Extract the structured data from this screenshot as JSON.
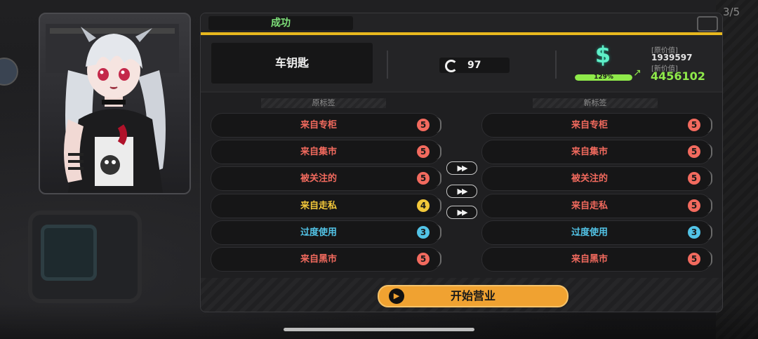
{
  "page_indicator": "3/5",
  "panel": {
    "status": "成功",
    "item_name": "车钥匙",
    "count": "97",
    "price": {
      "percent_text": "129%",
      "percent_fill": 1.0,
      "orig_label": "[原价值]",
      "orig_value": "1939597",
      "new_label": "[新价值]",
      "new_value": "4456102"
    },
    "left_header": "原标签",
    "right_header": "新标签",
    "left_tags": [
      {
        "label": "来自专柜",
        "value": "5",
        "color": "#f26a5e"
      },
      {
        "label": "来自集市",
        "value": "5",
        "color": "#f26a5e"
      },
      {
        "label": "被关注的",
        "value": "5",
        "color": "#f26a5e"
      },
      {
        "label": "来自走私",
        "value": "4",
        "color": "#f3c83a"
      },
      {
        "label": "过度使用",
        "value": "3",
        "color": "#52c3e6"
      },
      {
        "label": "来自黑市",
        "value": "5",
        "color": "#f26a5e"
      }
    ],
    "right_tags": [
      {
        "label": "来自专柜",
        "value": "5",
        "color": "#f26a5e"
      },
      {
        "label": "来自集市",
        "value": "5",
        "color": "#f26a5e"
      },
      {
        "label": "被关注的",
        "value": "5",
        "color": "#f26a5e"
      },
      {
        "label": "来自走私",
        "value": "5",
        "color": "#f26a5e"
      },
      {
        "label": "过度使用",
        "value": "3",
        "color": "#52c3e6"
      },
      {
        "label": "来自黑市",
        "value": "5",
        "color": "#f26a5e"
      }
    ],
    "arrow_glyph": "▶▶",
    "start_button_label": "开始营业",
    "start_icon": "play-icon"
  },
  "colors": {
    "accent_yellow": "#e8b81e",
    "success_green": "#7fe27a",
    "value_green": "#8fea4a",
    "button_orange": "#f0a231"
  }
}
